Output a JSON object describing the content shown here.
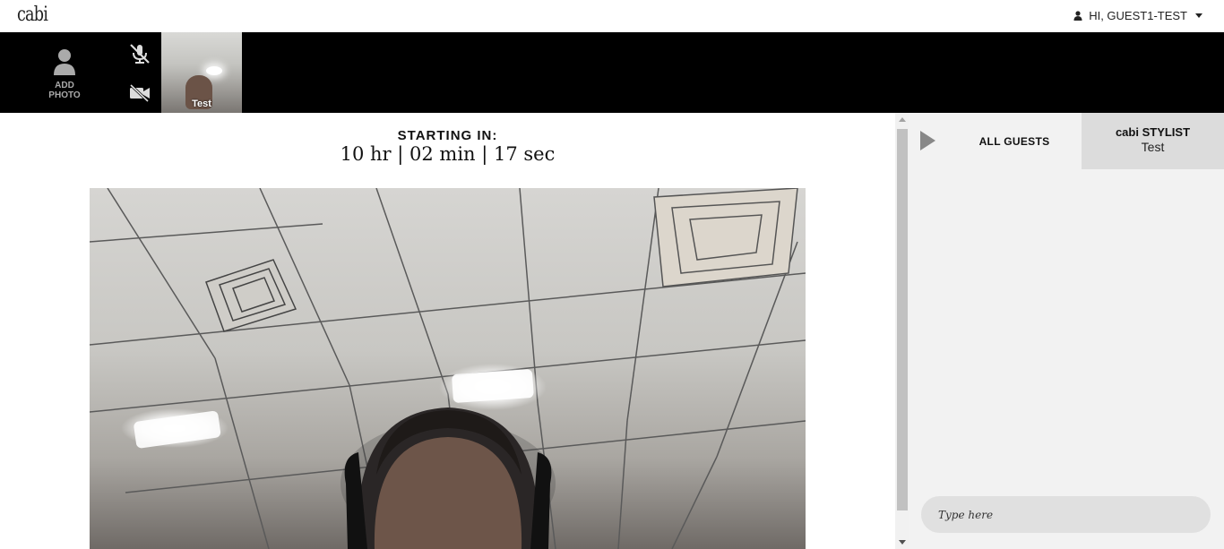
{
  "header": {
    "logo": "cabi",
    "user_greeting": "HI, GUEST1-TEST",
    "user_icon": "user-icon",
    "caret_icon": "caret-down-icon"
  },
  "participants_bar": {
    "add_photo_label_line1": "ADD",
    "add_photo_label_line2": "PHOTO",
    "mic_icon": "mic-muted-icon",
    "camera_icon": "camera-off-icon",
    "thumbnail_name": "Test"
  },
  "main": {
    "countdown_title": "STARTING IN:",
    "countdown_value": "10 hr | 02 min | 17 sec"
  },
  "chat_panel": {
    "toggle_icon": "play-triangle-icon",
    "tab_all_guests": "ALL GUESTS",
    "tab_stylist_title": "cabi STYLIST",
    "tab_stylist_name": "Test",
    "input_placeholder": "Type here"
  },
  "colors": {
    "strip_bg": "#000000",
    "panel_bg": "#f2f2f2",
    "stylist_tab_bg": "#dcdcdc"
  }
}
